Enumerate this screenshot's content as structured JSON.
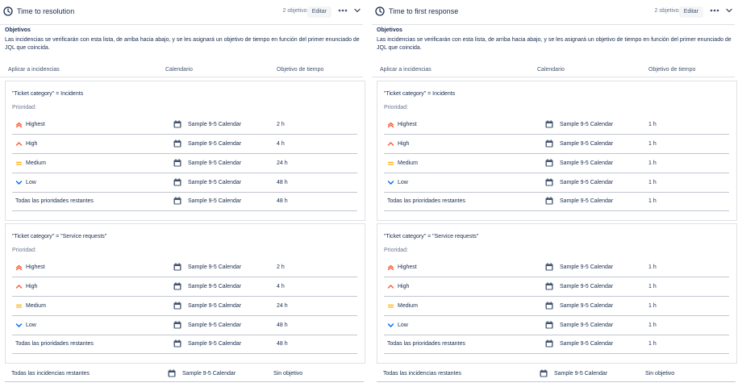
{
  "colors": {
    "highest": "#FF5630",
    "high": "#FF5630",
    "medium": "#FFAB00",
    "low": "#0065FF",
    "calendar": "#42526E"
  },
  "panels": [
    {
      "title": "Time to resolution",
      "count": "2 objetivos",
      "edit": "Editar",
      "objectives_heading": "Objetivos",
      "description": "Las incidencias se verificarán con esta lista, de arriba hacia abajo, y se les asignará un objetivo de tiempo en función del primer enunciado de JQL que coincida.",
      "columns": {
        "apply": "Aplicar a incidencias",
        "calendar": "Calendario",
        "goal": "Objetivo de tiempo"
      },
      "groups": [
        {
          "jql": "\"Ticket category\" = Incidents",
          "priority_label": "Prioridad:",
          "rows": [
            {
              "priority": "Highest",
              "icon": "highest-priority-icon",
              "calendar": "Sample 9-5 Calendar",
              "target": "2 h"
            },
            {
              "priority": "High",
              "icon": "high-priority-icon",
              "calendar": "Sample 9-5 Calendar",
              "target": "4 h"
            },
            {
              "priority": "Medium",
              "icon": "medium-priority-icon",
              "calendar": "Sample 9-5 Calendar",
              "target": "24 h"
            },
            {
              "priority": "Low",
              "icon": "low-priority-icon",
              "calendar": "Sample 9-5 Calendar",
              "target": "48 h"
            },
            {
              "priority": "Todas las prioridades restantes",
              "icon": "",
              "calendar": "Sample 9-5 Calendar",
              "target": "48 h"
            }
          ]
        },
        {
          "jql": "\"Ticket category\" = \"Service requests\"",
          "priority_label": "Prioridad:",
          "rows": [
            {
              "priority": "Highest",
              "icon": "highest-priority-icon",
              "calendar": "Sample 9-5 Calendar",
              "target": "2 h"
            },
            {
              "priority": "High",
              "icon": "high-priority-icon",
              "calendar": "Sample 9-5 Calendar",
              "target": "4 h"
            },
            {
              "priority": "Medium",
              "icon": "medium-priority-icon",
              "calendar": "Sample 9-5 Calendar",
              "target": "24 h"
            },
            {
              "priority": "Low",
              "icon": "low-priority-icon",
              "calendar": "Sample 9-5 Calendar",
              "target": "48 h"
            },
            {
              "priority": "Todas las prioridades restantes",
              "icon": "",
              "calendar": "Sample 9-5 Calendar",
              "target": "48 h"
            }
          ]
        }
      ],
      "footer": {
        "label": "Todas las incidencias restantes",
        "calendar": "Sample 9-5 Calendar",
        "target": "Sin objetivo"
      }
    },
    {
      "title": "Time to first response",
      "count": "2 objetivos",
      "edit": "Editar",
      "objectives_heading": "Objetivos",
      "description": "Las incidencias se verificarán con esta lista, de arriba hacia abajo, y se les asignará un objetivo de tiempo en función del primer enunciado de JQL que coincida.",
      "columns": {
        "apply": "Aplicar a incidencias",
        "calendar": "Calendario",
        "goal": "Objetivo de tiempo"
      },
      "groups": [
        {
          "jql": "\"Ticket category\" = Incidents",
          "priority_label": "Prioridad:",
          "rows": [
            {
              "priority": "Highest",
              "icon": "highest-priority-icon",
              "calendar": "Sample 9-5 Calendar",
              "target": "1 h"
            },
            {
              "priority": "High",
              "icon": "high-priority-icon",
              "calendar": "Sample 9-5 Calendar",
              "target": "1 h"
            },
            {
              "priority": "Medium",
              "icon": "medium-priority-icon",
              "calendar": "Sample 9-5 Calendar",
              "target": "1 h"
            },
            {
              "priority": "Low",
              "icon": "low-priority-icon",
              "calendar": "Sample 9-5 Calendar",
              "target": "1 h"
            },
            {
              "priority": "Todas las prioridades restantes",
              "icon": "",
              "calendar": "Sample 9-5 Calendar",
              "target": "1 h"
            }
          ]
        },
        {
          "jql": "\"Ticket category\" = \"Service requests\"",
          "priority_label": "Prioridad:",
          "rows": [
            {
              "priority": "Highest",
              "icon": "highest-priority-icon",
              "calendar": "Sample 9-5 Calendar",
              "target": "1 h"
            },
            {
              "priority": "High",
              "icon": "high-priority-icon",
              "calendar": "Sample 9-5 Calendar",
              "target": "1 h"
            },
            {
              "priority": "Medium",
              "icon": "medium-priority-icon",
              "calendar": "Sample 9-5 Calendar",
              "target": "1 h"
            },
            {
              "priority": "Low",
              "icon": "low-priority-icon",
              "calendar": "Sample 9-5 Calendar",
              "target": "1 h"
            },
            {
              "priority": "Todas las prioridades restantes",
              "icon": "",
              "calendar": "Sample 9-5 Calendar",
              "target": "1 h"
            }
          ]
        }
      ],
      "footer": {
        "label": "Todas las incidencias restantes",
        "calendar": "Sample 9-5 Calendar",
        "target": "Sin objetivo"
      }
    }
  ]
}
